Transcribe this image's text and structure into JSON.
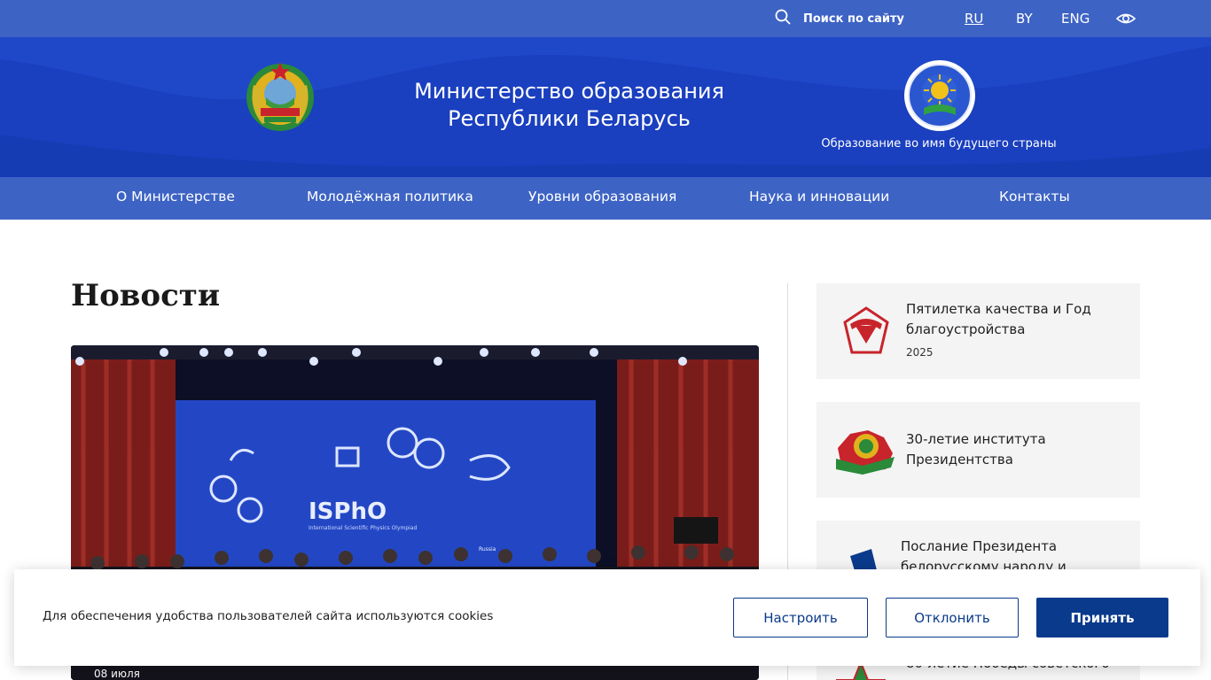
{
  "topbar": {
    "search_label": "Поиск по сайту",
    "languages": [
      "RU",
      "BY",
      "ENG"
    ],
    "active_language": "RU",
    "background": "#3d63c4"
  },
  "header": {
    "title_line1": "Министерство образования",
    "title_line2": "Республики Беларусь",
    "slogan": "Образование во имя будущего страны",
    "background": "#1a3fbf"
  },
  "nav": {
    "items": [
      {
        "label": "О Министерстве"
      },
      {
        "label": "Молодёжная политика"
      },
      {
        "label": "Уровни образования"
      },
      {
        "label": "Наука и инновации"
      },
      {
        "label": "Контакты"
      }
    ]
  },
  "main": {
    "section_title": "Новости",
    "hero": {
      "date": "08 июля",
      "screen_logo": "ISPhO",
      "screen_subtitle": "International Scientific Physics Olympiad",
      "sign": "Russia"
    }
  },
  "sidebar": {
    "cards": [
      {
        "line1": "Пятилетка качества и Год",
        "line2": "благоустройства",
        "year": "2025",
        "icon": "quality-mark-icon"
      },
      {
        "line1": "30-летие института",
        "line2": "Президентства",
        "icon": "belarus-map-emblem-icon"
      },
      {
        "line1": "Послание Президента",
        "line2": "белорусскому народу и",
        "icon": "flag-icon"
      },
      {
        "line1": "80-летие Победы советского",
        "icon": "star-icon"
      }
    ]
  },
  "cookie": {
    "text": "Для обеспечения удобства пользователей сайта используются cookies",
    "configure": "Настроить",
    "decline": "Отклонить",
    "accept": "Принять",
    "accent": "#0a3a8c"
  }
}
